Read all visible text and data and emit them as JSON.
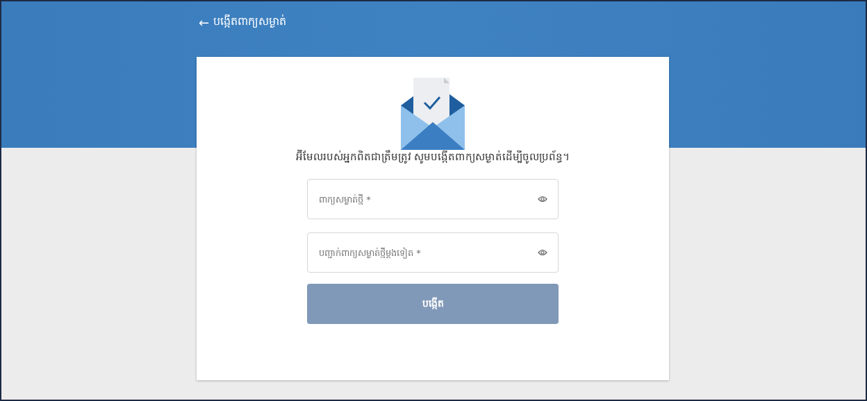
{
  "header": {
    "back_icon": "←",
    "title": "បង្កើតពាក្យសម្ងាត់"
  },
  "card": {
    "message": "អ៊ីមែលរបស់អ្នកពិតជាត្រឹមត្រូវ សូមបង្កើតពាក្យសម្ងាត់ដើម្បីចូលប្រព័ន្ធ។",
    "fields": [
      {
        "placeholder": "ពាក្យសម្ងាត់ថ្មី *"
      },
      {
        "placeholder": "បញ្ជាក់ពាក្យសម្ងាត់ថ្មីម្តងទៀត *"
      }
    ],
    "submit": {
      "label": "បង្កើត",
      "disabled": true
    }
  }
}
